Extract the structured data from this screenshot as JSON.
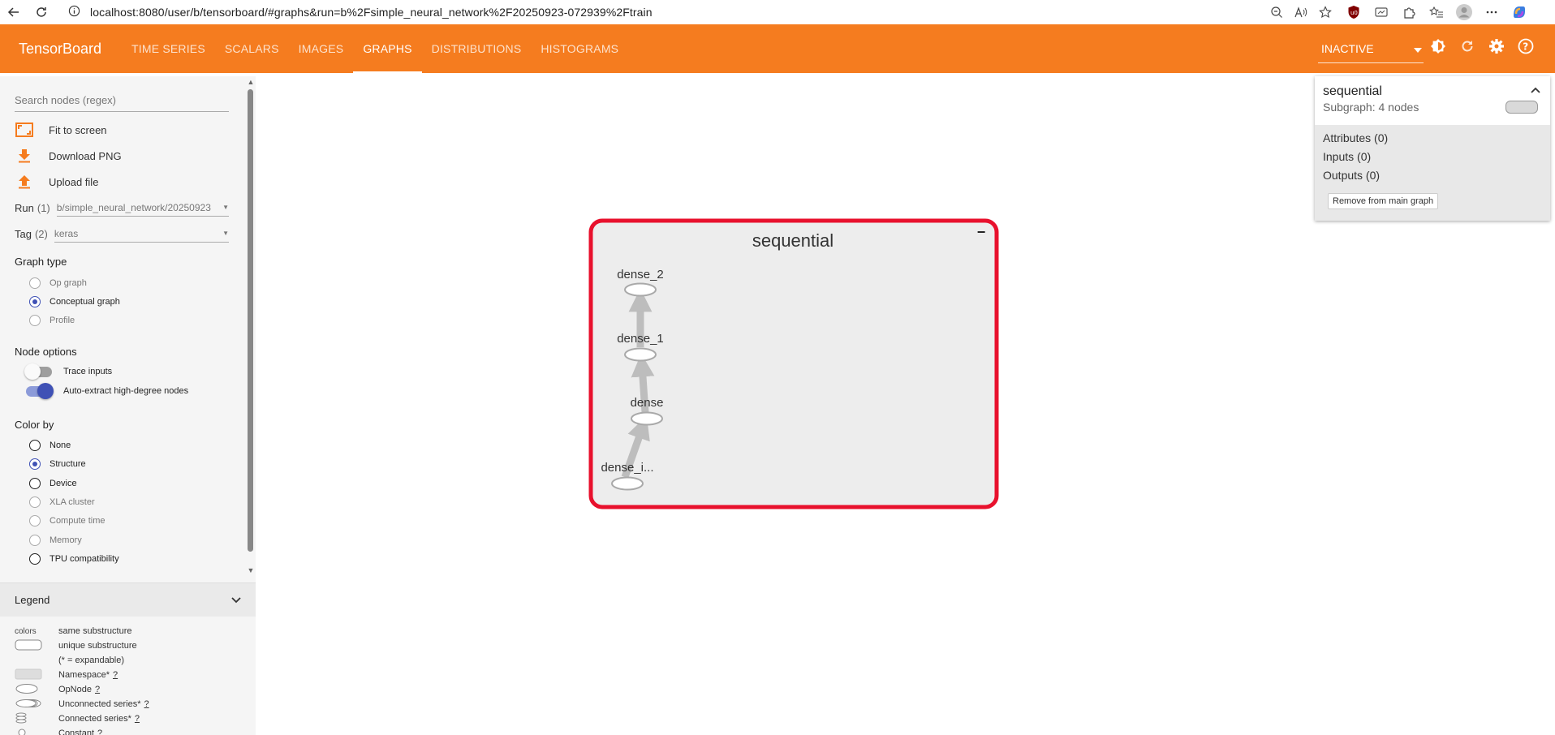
{
  "browser": {
    "url": "localhost:8080/user/b/tensorboard/#graphs&run=b%2Fsimple_neural_network%2F20250923-072939%2Ftrain"
  },
  "header": {
    "brand": "TensorBoard",
    "tabs": [
      {
        "label": "TIME SERIES"
      },
      {
        "label": "SCALARS"
      },
      {
        "label": "IMAGES"
      },
      {
        "label": "GRAPHS",
        "active": true
      },
      {
        "label": "DISTRIBUTIONS"
      },
      {
        "label": "HISTOGRAMS"
      }
    ],
    "run_state": "INACTIVE",
    "colors": {
      "bar": "#f57c1f"
    }
  },
  "sidebar": {
    "search_placeholder": "Search nodes (regex)",
    "actions": {
      "fit": "Fit to screen",
      "download": "Download PNG",
      "upload": "Upload file"
    },
    "run": {
      "label": "Run",
      "count": "(1)",
      "value": "b/simple_neural_network/20250923"
    },
    "tag": {
      "label": "Tag",
      "count": "(2)",
      "value": "keras"
    },
    "graph_type": {
      "title": "Graph type",
      "options": [
        "Op graph",
        "Conceptual graph",
        "Profile"
      ],
      "selected": "Conceptual graph"
    },
    "node_options": {
      "title": "Node options",
      "trace_inputs": "Trace inputs",
      "auto_extract": "Auto-extract high-degree nodes"
    },
    "color_by": {
      "title": "Color by",
      "options": [
        "None",
        "Structure",
        "Device",
        "XLA cluster",
        "Compute time",
        "Memory",
        "TPU compatibility"
      ],
      "selected": "Structure"
    }
  },
  "legend": {
    "title": "Legend",
    "colors_label": "colors",
    "same_sub": "same substructure",
    "unique_sub": "unique substructure",
    "expandable_note": "(* = expandable)",
    "namespace": "Namespace*",
    "opnode": "OpNode",
    "unconnected": "Unconnected series*",
    "connected": "Connected series*",
    "constant": "Constant",
    "help": "?"
  },
  "graph": {
    "title": "sequential",
    "collapse": "−",
    "nodes": [
      "dense_2",
      "dense_1",
      "dense",
      "dense_i..."
    ],
    "highlight_color": "#e8112d",
    "edge_color": "#bdbdbd"
  },
  "info_card": {
    "title": "sequential",
    "subtitle": "Subgraph: 4 nodes",
    "attributes": "Attributes (0)",
    "inputs": "Inputs (0)",
    "outputs": "Outputs (0)",
    "remove_button": "Remove from main graph"
  }
}
